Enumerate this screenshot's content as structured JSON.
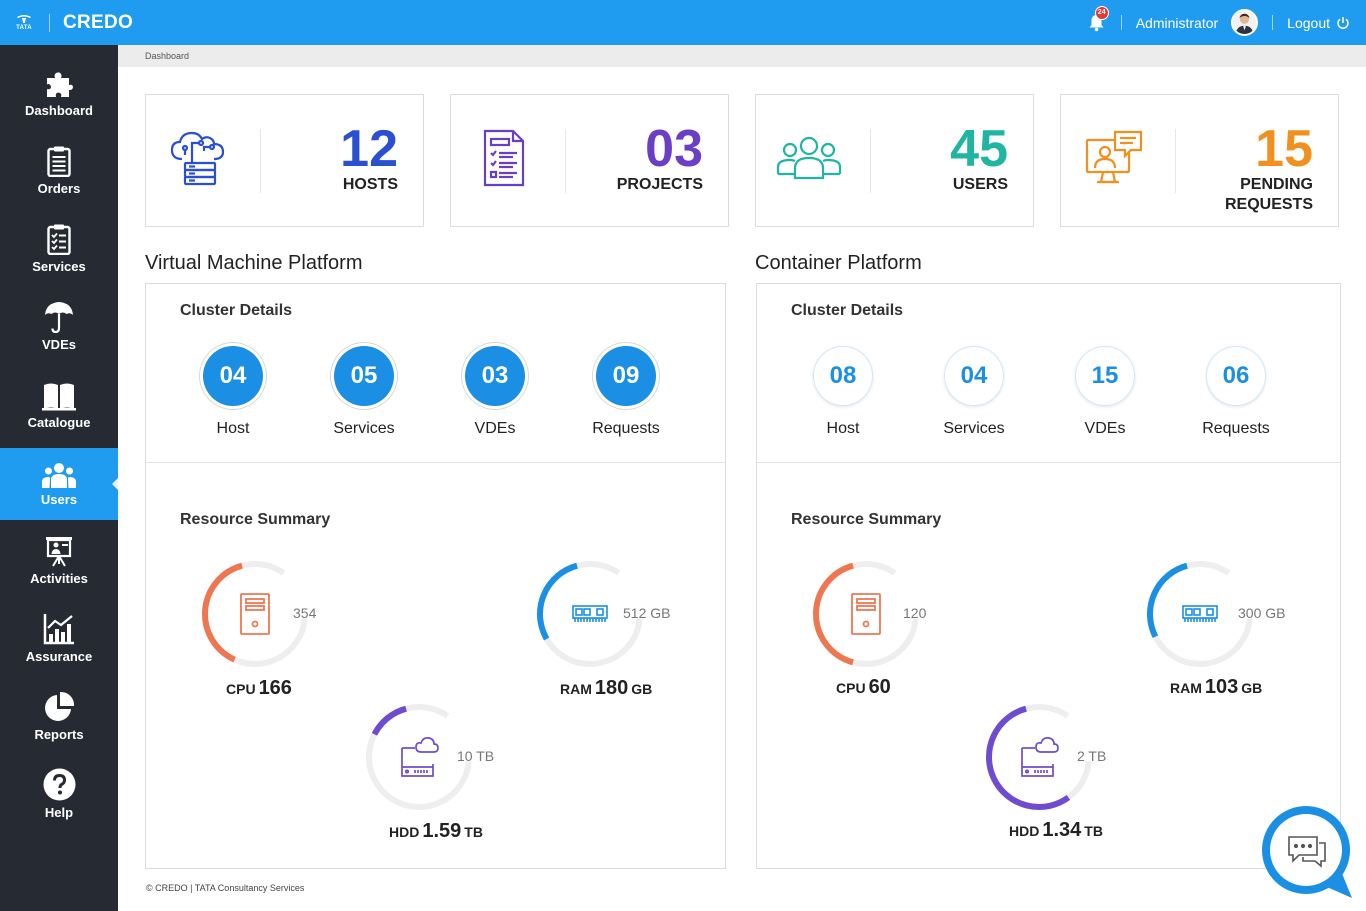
{
  "header": {
    "logo_text": "TATA",
    "app_name": "CREDO",
    "notification_count": "24",
    "user_name": "Administrator",
    "logout_label": "Logout"
  },
  "sidebar": {
    "items": [
      {
        "label": "Dashboard",
        "icon": "puzzle-icon"
      },
      {
        "label": "Orders",
        "icon": "clipboard-icon"
      },
      {
        "label": "Services",
        "icon": "checklist-icon"
      },
      {
        "label": "VDEs",
        "icon": "umbrella-icon"
      },
      {
        "label": "Catalogue",
        "icon": "book-icon"
      },
      {
        "label": "Users",
        "icon": "users-icon",
        "active": true
      },
      {
        "label": "Activities",
        "icon": "presentation-icon"
      },
      {
        "label": "Assurance",
        "icon": "chart-icon"
      },
      {
        "label": "Reports",
        "icon": "pie-chart-icon"
      },
      {
        "label": "Help",
        "icon": "help-icon"
      }
    ]
  },
  "breadcrumb": "Dashboard",
  "stats": [
    {
      "value": "12",
      "label": "HOSTS",
      "color": "#2a4fd0",
      "icon": "cloud-server-icon"
    },
    {
      "value": "03",
      "label": "PROJECTS",
      "color": "#6a3fc6",
      "icon": "document-list-icon"
    },
    {
      "value": "45",
      "label": "USERS",
      "color": "#1fb5a0",
      "icon": "group-icon"
    },
    {
      "value": "15",
      "label_line1": "PENDING",
      "label_line2": "REQUESTS",
      "color": "#f0901e",
      "icon": "support-desk-icon"
    }
  ],
  "vm_platform": {
    "title": "Virtual Machine Platform",
    "cluster_title": "Cluster Details",
    "cluster": [
      {
        "value": "04",
        "label": "Host"
      },
      {
        "value": "05",
        "label": "Services"
      },
      {
        "value": "03",
        "label": "VDEs"
      },
      {
        "value": "09",
        "label": "Requests"
      }
    ],
    "resource_title": "Resource Summary",
    "cpu": {
      "label": "CPU",
      "value": "166",
      "unit": "",
      "total": "354",
      "fraction": 0.47
    },
    "ram": {
      "label": "RAM",
      "value": "180",
      "unit": "GB",
      "total": "512 GB",
      "fraction": 0.35
    },
    "hdd": {
      "label": "HDD",
      "value": "1.59",
      "unit": "TB",
      "total": "10 TB",
      "fraction": 0.16
    }
  },
  "container_platform": {
    "title": "Container Platform",
    "cluster_title": "Cluster Details",
    "cluster": [
      {
        "value": "08",
        "label": "Host"
      },
      {
        "value": "04",
        "label": "Services"
      },
      {
        "value": "15",
        "label": "VDEs"
      },
      {
        "value": "06",
        "label": "Requests"
      }
    ],
    "resource_title": "Resource Summary",
    "cpu": {
      "label": "CPU",
      "value": "60",
      "unit": "",
      "total": "120",
      "fraction": 0.5
    },
    "ram": {
      "label": "RAM",
      "value": "103",
      "unit": "GB",
      "total": "300 GB",
      "fraction": 0.34
    },
    "hdd": {
      "label": "HDD",
      "value": "1.34",
      "unit": "TB",
      "total": "2 TB",
      "fraction": 0.67
    }
  },
  "footer": "© CREDO | TATA Consultancy Services",
  "colors": {
    "brand": "#1f9bf0",
    "sidebar": "#262b33",
    "cpu": "#ee7752",
    "ram": "#1a8fe3",
    "hdd": "#6e4ccf"
  }
}
